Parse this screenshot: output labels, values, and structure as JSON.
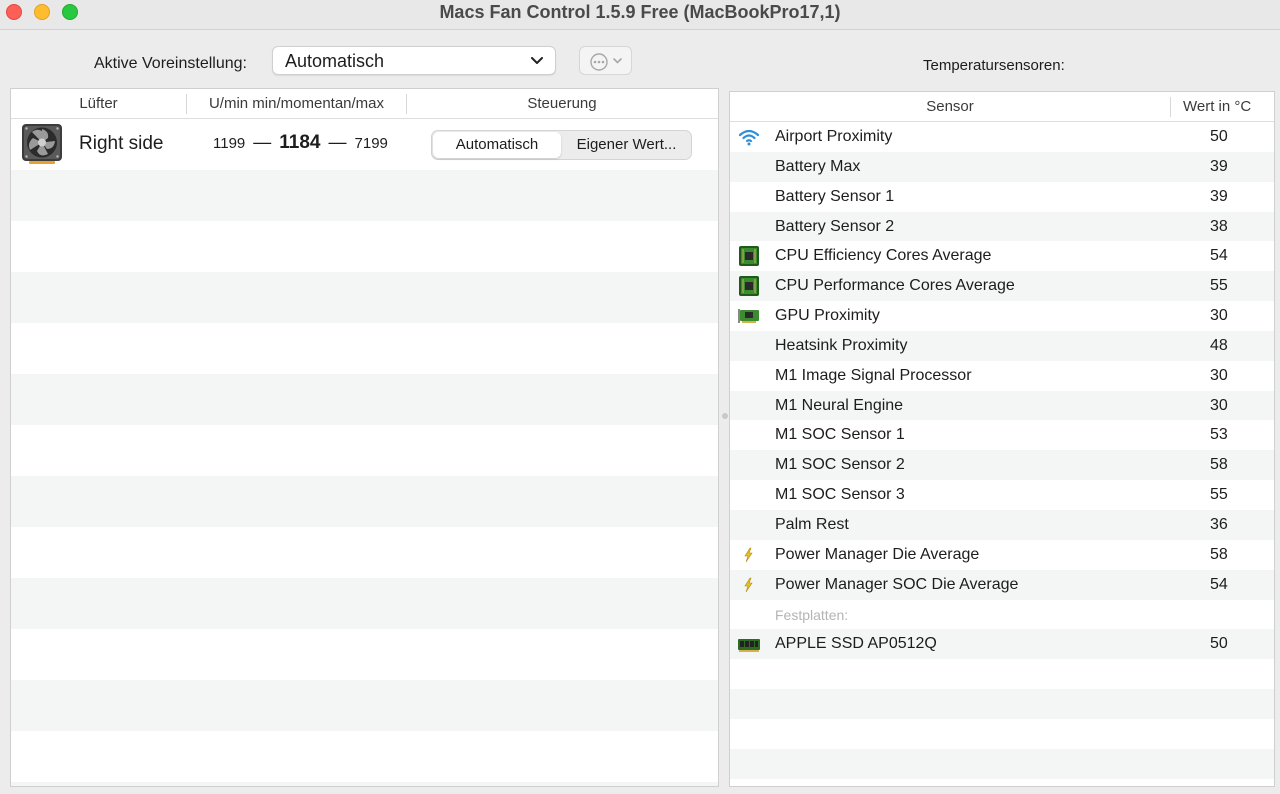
{
  "window": {
    "title": "Macs Fan Control 1.5.9 Free (MacBookPro17,1)"
  },
  "toolbar": {
    "preset_label": "Aktive Voreinstellung:",
    "preset_value": "Automatisch",
    "sensors_title": "Temperatursensoren:"
  },
  "fans": {
    "headers": {
      "fan": "Lüfter",
      "rpm": "U/min min/momentan/max",
      "control": "Steuerung"
    },
    "rows": [
      {
        "name": "Right side",
        "min": "1199",
        "current": "1184",
        "max": "7199",
        "control_auto": "Automatisch",
        "control_custom": "Eigener Wert..."
      }
    ]
  },
  "sensors": {
    "headers": {
      "sensor": "Sensor",
      "value": "Wert in °C"
    },
    "rows": [
      {
        "name": "Airport Proximity",
        "value": "50",
        "icon": "wifi-icon"
      },
      {
        "name": "Battery Max",
        "value": "39",
        "icon": ""
      },
      {
        "name": "Battery Sensor 1",
        "value": "39",
        "icon": ""
      },
      {
        "name": "Battery Sensor 2",
        "value": "38",
        "icon": ""
      },
      {
        "name": "CPU Efficiency Cores Average",
        "value": "54",
        "icon": "cpu-chip-icon"
      },
      {
        "name": "CPU Performance Cores Average",
        "value": "55",
        "icon": "cpu-chip-icon"
      },
      {
        "name": "GPU Proximity",
        "value": "30",
        "icon": "gpu-card-icon"
      },
      {
        "name": "Heatsink Proximity",
        "value": "48",
        "icon": ""
      },
      {
        "name": "M1 Image Signal Processor",
        "value": "30",
        "icon": ""
      },
      {
        "name": "M1 Neural Engine",
        "value": "30",
        "icon": ""
      },
      {
        "name": "M1 SOC Sensor 1",
        "value": "53",
        "icon": ""
      },
      {
        "name": "M1 SOC Sensor 2",
        "value": "58",
        "icon": ""
      },
      {
        "name": "M1 SOC Sensor 3",
        "value": "55",
        "icon": ""
      },
      {
        "name": "Palm Rest",
        "value": "36",
        "icon": ""
      },
      {
        "name": "Power Manager Die Average",
        "value": "58",
        "icon": "lightning-icon"
      },
      {
        "name": "Power Manager SOC Die Average",
        "value": "54",
        "icon": "lightning-icon"
      },
      {
        "name": "Festplatten:",
        "value": "",
        "icon": "",
        "group": true
      },
      {
        "name": "APPLE SSD AP0512Q",
        "value": "50",
        "icon": "ssd-icon"
      }
    ]
  },
  "colors": {
    "accent_wifi": "#2f8fd8",
    "chip_green": "#3b8c2f",
    "stripe": "#f4f5f5"
  }
}
